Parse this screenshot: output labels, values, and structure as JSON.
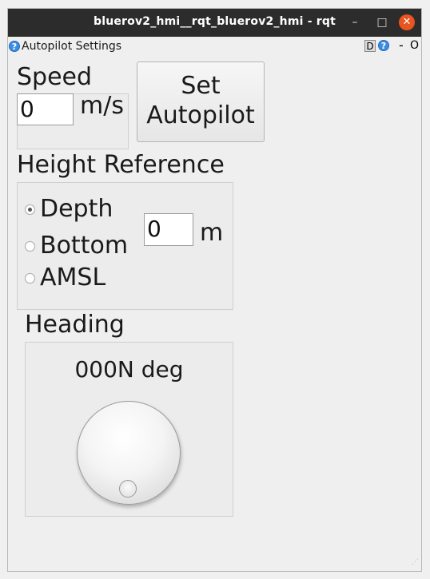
{
  "window": {
    "title": "bluerov2_hmi__rqt_bluerov2_hmi - rqt",
    "minimize_glyph": "–",
    "maximize_glyph": "□",
    "close_glyph": "✕"
  },
  "plugin_bar": {
    "title": "Autopilot Settings",
    "help_glyph": "?",
    "d_label": "D",
    "dash_label": "-",
    "o_label": "O"
  },
  "speed": {
    "label": "Speed",
    "value": "0",
    "unit": "m/s"
  },
  "set_autopilot": {
    "line1": "Set",
    "line2": "Autopilot"
  },
  "height": {
    "label": "Height Reference",
    "options": [
      {
        "label": "Depth",
        "checked": true
      },
      {
        "label": "Bottom",
        "checked": false
      },
      {
        "label": "AMSL",
        "checked": false
      }
    ],
    "value": "0",
    "unit": "m"
  },
  "heading": {
    "label": "Heading",
    "readout": "000N deg",
    "dial_value_deg": 0
  }
}
